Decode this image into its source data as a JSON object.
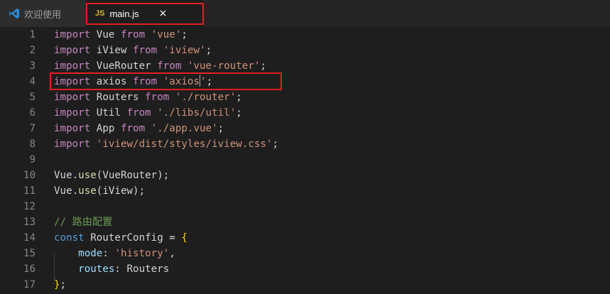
{
  "tabs": {
    "welcome": {
      "icon": "vscode-icon",
      "label": "欢迎使用"
    },
    "main": {
      "badge": "JS",
      "label": "main.js",
      "close": "×"
    }
  },
  "editor": {
    "lines": [
      {
        "no": "1",
        "tokens": [
          [
            "kw",
            "import"
          ],
          [
            "id",
            " Vue "
          ],
          [
            "kw",
            "from"
          ],
          [
            "id",
            " "
          ],
          [
            "str",
            "'vue'"
          ],
          [
            "id",
            ";"
          ]
        ]
      },
      {
        "no": "2",
        "tokens": [
          [
            "kw",
            "import"
          ],
          [
            "id",
            " iView "
          ],
          [
            "kw",
            "from"
          ],
          [
            "id",
            " "
          ],
          [
            "str",
            "'iview'"
          ],
          [
            "id",
            ";"
          ]
        ]
      },
      {
        "no": "3",
        "tokens": [
          [
            "kw",
            "import"
          ],
          [
            "id",
            " VueRouter "
          ],
          [
            "kw",
            "from"
          ],
          [
            "id",
            " "
          ],
          [
            "str",
            "'vue-router'"
          ],
          [
            "id",
            ";"
          ]
        ]
      },
      {
        "no": "4",
        "tokens": [
          [
            "kw",
            "import"
          ],
          [
            "id",
            " axios "
          ],
          [
            "kw",
            "from"
          ],
          [
            "id",
            " "
          ],
          [
            "str",
            "'axios"
          ],
          [
            "cursor",
            ""
          ],
          [
            "str",
            "'"
          ],
          [
            "id",
            ";"
          ]
        ]
      },
      {
        "no": "5",
        "tokens": [
          [
            "kw",
            "import"
          ],
          [
            "id",
            " Routers "
          ],
          [
            "kw",
            "from"
          ],
          [
            "id",
            " "
          ],
          [
            "str",
            "'./router'"
          ],
          [
            "id",
            ";"
          ]
        ]
      },
      {
        "no": "6",
        "tokens": [
          [
            "kw",
            "import"
          ],
          [
            "id",
            " Util "
          ],
          [
            "kw",
            "from"
          ],
          [
            "id",
            " "
          ],
          [
            "str",
            "'./libs/util'"
          ],
          [
            "id",
            ";"
          ]
        ]
      },
      {
        "no": "7",
        "tokens": [
          [
            "kw",
            "import"
          ],
          [
            "id",
            " App "
          ],
          [
            "kw",
            "from"
          ],
          [
            "id",
            " "
          ],
          [
            "str",
            "'./app.vue'"
          ],
          [
            "id",
            ";"
          ]
        ]
      },
      {
        "no": "8",
        "tokens": [
          [
            "kw",
            "import"
          ],
          [
            "id",
            " "
          ],
          [
            "str",
            "'iview/dist/styles/iview.css'"
          ],
          [
            "id",
            ";"
          ]
        ]
      },
      {
        "no": "9",
        "tokens": []
      },
      {
        "no": "10",
        "tokens": [
          [
            "id",
            "Vue."
          ],
          [
            "fn",
            "use"
          ],
          [
            "id",
            "(VueRouter);"
          ]
        ]
      },
      {
        "no": "11",
        "tokens": [
          [
            "id",
            "Vue."
          ],
          [
            "fn",
            "use"
          ],
          [
            "id",
            "(iView);"
          ]
        ]
      },
      {
        "no": "12",
        "tokens": []
      },
      {
        "no": "13",
        "tokens": [
          [
            "cmt",
            "// 路由配置"
          ]
        ]
      },
      {
        "no": "14",
        "tokens": [
          [
            "con",
            "const"
          ],
          [
            "id",
            " RouterConfig = "
          ],
          [
            "brace",
            "{"
          ]
        ]
      },
      {
        "no": "15",
        "tokens": [
          [
            "id",
            "    "
          ],
          [
            "prop",
            "mode"
          ],
          [
            "id",
            ": "
          ],
          [
            "str",
            "'history'"
          ],
          [
            "id",
            ","
          ]
        ]
      },
      {
        "no": "16",
        "tokens": [
          [
            "id",
            "    "
          ],
          [
            "prop",
            "routes"
          ],
          [
            "id",
            ": Routers"
          ]
        ]
      },
      {
        "no": "17",
        "tokens": [
          [
            "brace",
            "}"
          ],
          [
            "id",
            ";"
          ]
        ]
      }
    ]
  },
  "colors": {
    "background": "#1e1e1e",
    "keyword": "#c586c0",
    "string": "#ce9178",
    "comment": "#6a9955",
    "function": "#dcdcaa",
    "highlight_box": "#e02020"
  }
}
